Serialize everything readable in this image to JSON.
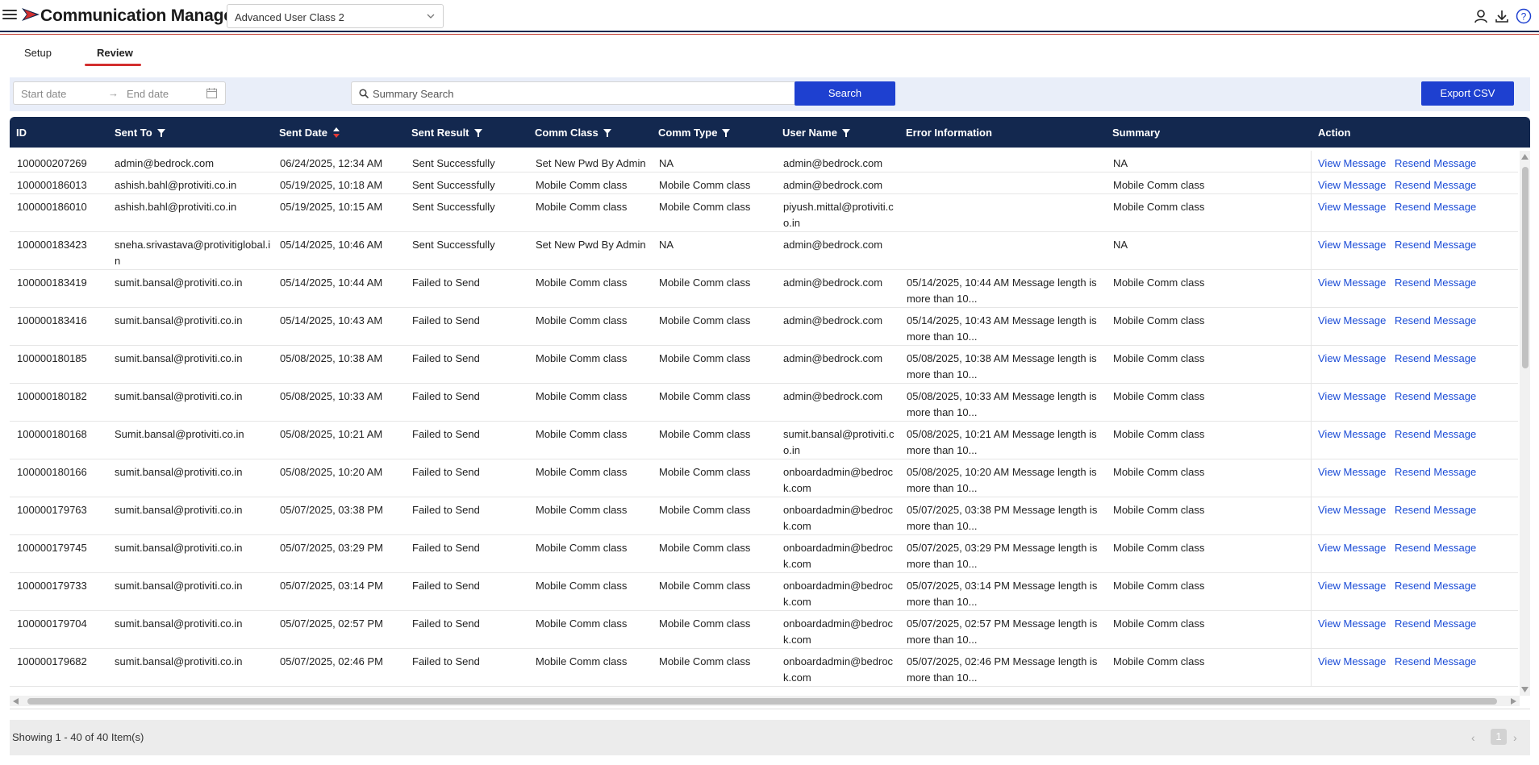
{
  "header": {
    "title": "Communication Manager",
    "class_select": "Advanced User Class 2",
    "icons": [
      "menu-icon",
      "brand-logo-icon",
      "user-icon",
      "download-icon",
      "help-icon"
    ],
    "colors": {
      "navy": "#13284f",
      "accent_red": "#d32f2f",
      "primary_blue": "#1e40d0",
      "link_blue": "#1a4bd6"
    }
  },
  "tabs": [
    {
      "label": "Setup",
      "active": false
    },
    {
      "label": "Review",
      "active": true
    }
  ],
  "filters": {
    "start_placeholder": "Start date",
    "end_placeholder": "End date",
    "arrow": "→",
    "search_placeholder": "Summary Search",
    "search_label": "Search",
    "export_label": "Export CSV"
  },
  "table": {
    "columns": [
      {
        "label": "ID",
        "filter": false,
        "sort": false
      },
      {
        "label": "Sent To",
        "filter": true,
        "sort": false
      },
      {
        "label": "Sent Date",
        "filter": false,
        "sort": true
      },
      {
        "label": "Sent Result",
        "filter": true,
        "sort": false
      },
      {
        "label": "Comm Class",
        "filter": true,
        "sort": false
      },
      {
        "label": "Comm Type",
        "filter": true,
        "sort": false
      },
      {
        "label": "User Name",
        "filter": true,
        "sort": false
      },
      {
        "label": "Error Information",
        "filter": false,
        "sort": false
      },
      {
        "label": "Summary",
        "filter": false,
        "sort": false
      },
      {
        "label": "Action",
        "filter": false,
        "sort": false
      }
    ],
    "actions": {
      "view": "View Message",
      "resend": "Resend Message"
    },
    "rows": [
      {
        "id": "100000207269",
        "sent_to": "admin@bedrock.com",
        "sent_date": "06/24/2025, 12:34 AM",
        "result": "Sent Successfully",
        "comm_class": "Set New Pwd By Admin",
        "comm_type": "NA",
        "user_name": "admin@bedrock.com",
        "error": "",
        "summary": "NA"
      },
      {
        "id": "100000186013",
        "sent_to": "ashish.bahl@protiviti.co.in",
        "sent_date": "05/19/2025, 10:18 AM",
        "result": "Sent Successfully",
        "comm_class": "Mobile Comm class",
        "comm_type": "Mobile Comm class",
        "user_name": "admin@bedrock.com",
        "error": "",
        "summary": "Mobile Comm class"
      },
      {
        "id": "100000186010",
        "sent_to": "ashish.bahl@protiviti.co.in",
        "sent_date": "05/19/2025, 10:15 AM",
        "result": "Sent Successfully",
        "comm_class": "Mobile Comm class",
        "comm_type": "Mobile Comm class",
        "user_name": "piyush.mittal@protiviti.co.in",
        "error": "",
        "summary": "Mobile Comm class"
      },
      {
        "id": "100000183423",
        "sent_to": "sneha.srivastava@protivitiglobal.in",
        "sent_date": "05/14/2025, 10:46 AM",
        "result": "Sent Successfully",
        "comm_class": "Set New Pwd By Admin",
        "comm_type": "NA",
        "user_name": "admin@bedrock.com",
        "error": "",
        "summary": "NA"
      },
      {
        "id": "100000183419",
        "sent_to": "sumit.bansal@protiviti.co.in",
        "sent_date": "05/14/2025, 10:44 AM",
        "result": "Failed to Send",
        "comm_class": "Mobile Comm class",
        "comm_type": "Mobile Comm class",
        "user_name": "admin@bedrock.com",
        "error": "05/14/2025, 10:44 AM Message length is more than 10...",
        "summary": "Mobile Comm class"
      },
      {
        "id": "100000183416",
        "sent_to": "sumit.bansal@protiviti.co.in",
        "sent_date": "05/14/2025, 10:43 AM",
        "result": "Failed to Send",
        "comm_class": "Mobile Comm class",
        "comm_type": "Mobile Comm class",
        "user_name": "admin@bedrock.com",
        "error": "05/14/2025, 10:43 AM Message length is more than 10...",
        "summary": "Mobile Comm class"
      },
      {
        "id": "100000180185",
        "sent_to": "sumit.bansal@protiviti.co.in",
        "sent_date": "05/08/2025, 10:38 AM",
        "result": "Failed to Send",
        "comm_class": "Mobile Comm class",
        "comm_type": "Mobile Comm class",
        "user_name": "admin@bedrock.com",
        "error": "05/08/2025, 10:38 AM Message length is more than 10...",
        "summary": "Mobile Comm class"
      },
      {
        "id": "100000180182",
        "sent_to": "sumit.bansal@protiviti.co.in",
        "sent_date": "05/08/2025, 10:33 AM",
        "result": "Failed to Send",
        "comm_class": "Mobile Comm class",
        "comm_type": "Mobile Comm class",
        "user_name": "admin@bedrock.com",
        "error": "05/08/2025, 10:33 AM Message length is more than 10...",
        "summary": "Mobile Comm class"
      },
      {
        "id": "100000180168",
        "sent_to": "Sumit.bansal@protiviti.co.in",
        "sent_date": "05/08/2025, 10:21 AM",
        "result": "Failed to Send",
        "comm_class": "Mobile Comm class",
        "comm_type": "Mobile Comm class",
        "user_name": "sumit.bansal@protiviti.co.in",
        "error": "05/08/2025, 10:21 AM Message length is more than 10...",
        "summary": "Mobile Comm class"
      },
      {
        "id": "100000180166",
        "sent_to": "sumit.bansal@protiviti.co.in",
        "sent_date": "05/08/2025, 10:20 AM",
        "result": "Failed to Send",
        "comm_class": "Mobile Comm class",
        "comm_type": "Mobile Comm class",
        "user_name": "onboardadmin@bedrock.com",
        "error": "05/08/2025, 10:20 AM Message length is more than 10...",
        "summary": "Mobile Comm class"
      },
      {
        "id": "100000179763",
        "sent_to": "sumit.bansal@protiviti.co.in",
        "sent_date": "05/07/2025, 03:38 PM",
        "result": "Failed to Send",
        "comm_class": "Mobile Comm class",
        "comm_type": "Mobile Comm class",
        "user_name": "onboardadmin@bedrock.com",
        "error": "05/07/2025, 03:38 PM Message length is more than 10...",
        "summary": "Mobile Comm class"
      },
      {
        "id": "100000179745",
        "sent_to": "sumit.bansal@protiviti.co.in",
        "sent_date": "05/07/2025, 03:29 PM",
        "result": "Failed to Send",
        "comm_class": "Mobile Comm class",
        "comm_type": "Mobile Comm class",
        "user_name": "onboardadmin@bedrock.com",
        "error": "05/07/2025, 03:29 PM Message length is more than 10...",
        "summary": "Mobile Comm class"
      },
      {
        "id": "100000179733",
        "sent_to": "sumit.bansal@protiviti.co.in",
        "sent_date": "05/07/2025, 03:14 PM",
        "result": "Failed to Send",
        "comm_class": "Mobile Comm class",
        "comm_type": "Mobile Comm class",
        "user_name": "onboardadmin@bedrock.com",
        "error": "05/07/2025, 03:14 PM Message length is more than 10...",
        "summary": "Mobile Comm class"
      },
      {
        "id": "100000179704",
        "sent_to": "sumit.bansal@protiviti.co.in",
        "sent_date": "05/07/2025, 02:57 PM",
        "result": "Failed to Send",
        "comm_class": "Mobile Comm class",
        "comm_type": "Mobile Comm class",
        "user_name": "onboardadmin@bedrock.com",
        "error": "05/07/2025, 02:57 PM Message length is more than 10...",
        "summary": "Mobile Comm class"
      },
      {
        "id": "100000179682",
        "sent_to": "sumit.bansal@protiviti.co.in",
        "sent_date": "05/07/2025, 02:46 PM",
        "result": "Failed to Send",
        "comm_class": "Mobile Comm class",
        "comm_type": "Mobile Comm class",
        "user_name": "onboardadmin@bedrock.com",
        "error": "05/07/2025, 02:46 PM Message length is more than 10...",
        "summary": "Mobile Comm class"
      }
    ]
  },
  "footer": {
    "count_text": "Showing 1 - 40 of 40 Item(s)",
    "current_page": "1",
    "prev": "‹",
    "next": "›"
  }
}
